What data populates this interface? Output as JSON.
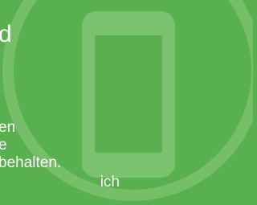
{
  "screen": {
    "headline": "d",
    "body_lines": [
      "en",
      "e",
      "behalten.",
      "                        ich"
    ]
  },
  "illustration": {
    "icon": "smartphone-icon"
  },
  "colors": {
    "background": "#59b04e",
    "ring": "#7bc26f",
    "device": "#77c06b",
    "text": "#ffffff"
  }
}
